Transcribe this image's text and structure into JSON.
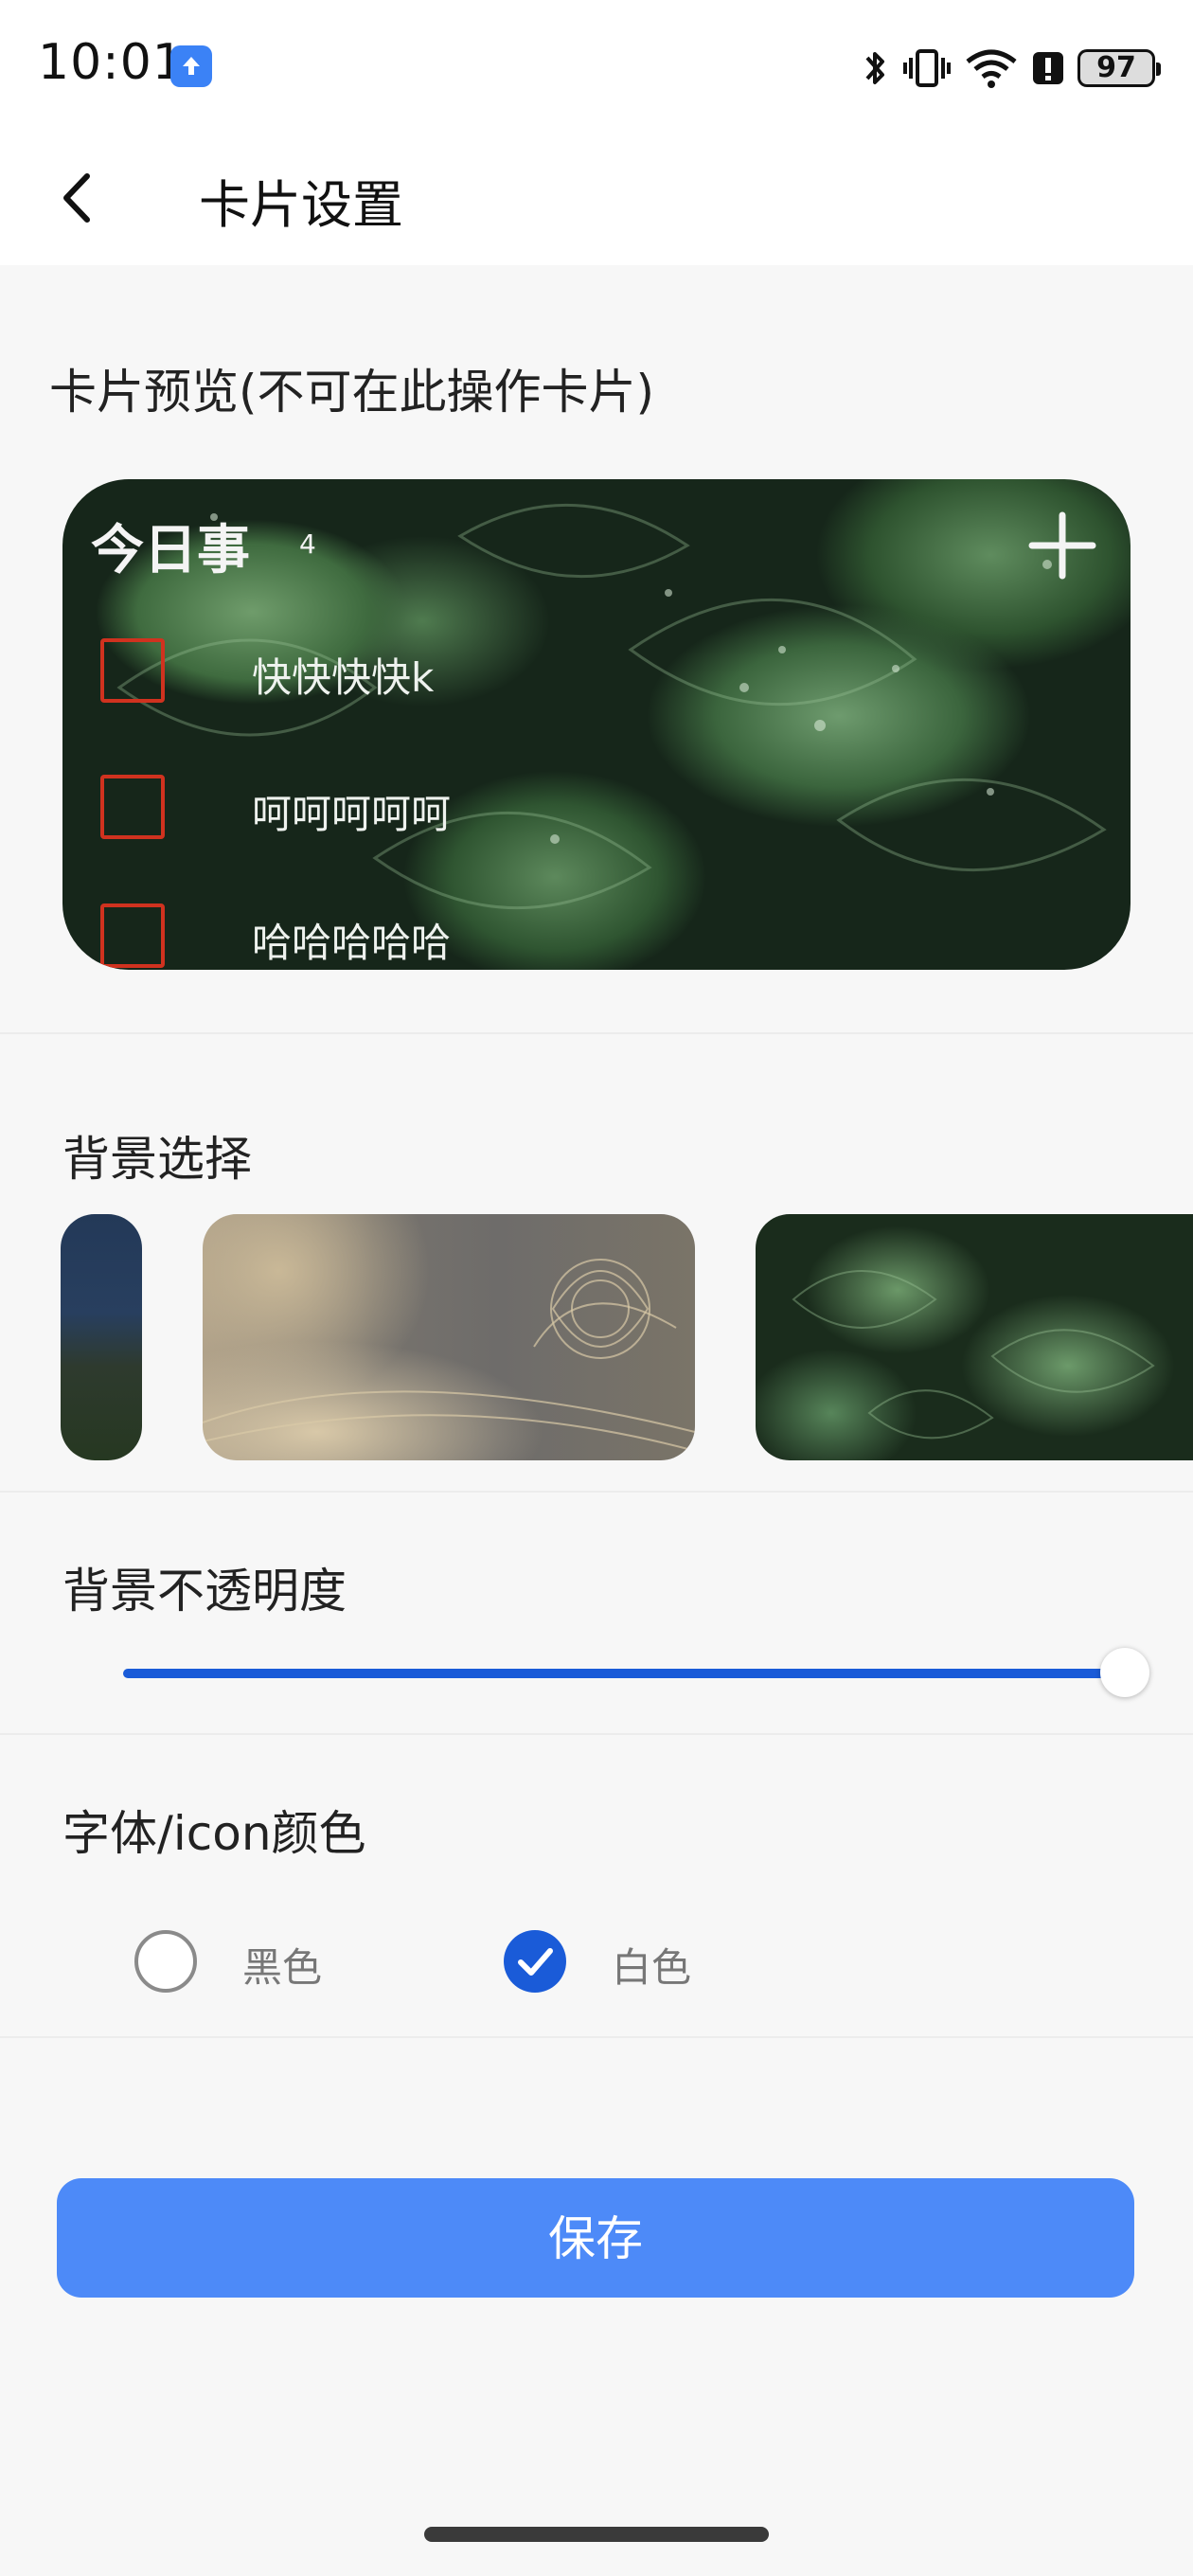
{
  "status_bar": {
    "time": "10:01",
    "battery": "97",
    "icons": [
      "app-upload-icon",
      "bluetooth-icon",
      "vibrate-icon",
      "wifi-6-icon",
      "alert-icon",
      "battery-icon"
    ]
  },
  "header": {
    "title": "卡片设置",
    "back_icon": "chevron-left-icon"
  },
  "preview": {
    "label": "卡片预览(不可在此操作卡片)",
    "card": {
      "title": "今日事",
      "count": "4",
      "add_icon": "plus-icon",
      "items": [
        {
          "text": "快快快快k"
        },
        {
          "text": "呵呵呵呵呵"
        },
        {
          "text": "哈哈哈哈哈"
        }
      ]
    }
  },
  "background": {
    "label": "背景选择",
    "options": [
      "night-landscape",
      "gold-floral",
      "green-leaves"
    ]
  },
  "opacity": {
    "label": "背景不透明度",
    "value_fraction": 1.0
  },
  "font_color": {
    "label": "字体/icon颜色",
    "options": [
      {
        "label": "黑色",
        "selected": false
      },
      {
        "label": "白色",
        "selected": true
      }
    ]
  },
  "actions": {
    "save_label": "保存"
  },
  "colors": {
    "accent": "#1a5bd8",
    "save_button": "#4d8af8",
    "checkbox_border": "#d0321f"
  }
}
